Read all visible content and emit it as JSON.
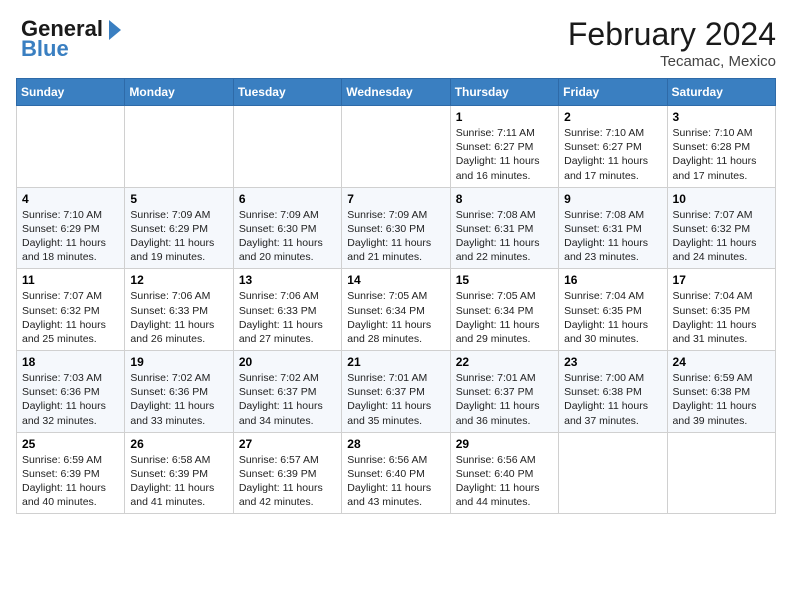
{
  "header": {
    "logo_line1": "General",
    "logo_line2": "Blue",
    "month_title": "February 2024",
    "location": "Tecamac, Mexico"
  },
  "weekdays": [
    "Sunday",
    "Monday",
    "Tuesday",
    "Wednesday",
    "Thursday",
    "Friday",
    "Saturday"
  ],
  "weeks": [
    [
      {
        "day": "",
        "info": ""
      },
      {
        "day": "",
        "info": ""
      },
      {
        "day": "",
        "info": ""
      },
      {
        "day": "",
        "info": ""
      },
      {
        "day": "1",
        "info": "Sunrise: 7:11 AM\nSunset: 6:27 PM\nDaylight: 11 hours and 16 minutes."
      },
      {
        "day": "2",
        "info": "Sunrise: 7:10 AM\nSunset: 6:27 PM\nDaylight: 11 hours and 17 minutes."
      },
      {
        "day": "3",
        "info": "Sunrise: 7:10 AM\nSunset: 6:28 PM\nDaylight: 11 hours and 17 minutes."
      }
    ],
    [
      {
        "day": "4",
        "info": "Sunrise: 7:10 AM\nSunset: 6:29 PM\nDaylight: 11 hours and 18 minutes."
      },
      {
        "day": "5",
        "info": "Sunrise: 7:09 AM\nSunset: 6:29 PM\nDaylight: 11 hours and 19 minutes."
      },
      {
        "day": "6",
        "info": "Sunrise: 7:09 AM\nSunset: 6:30 PM\nDaylight: 11 hours and 20 minutes."
      },
      {
        "day": "7",
        "info": "Sunrise: 7:09 AM\nSunset: 6:30 PM\nDaylight: 11 hours and 21 minutes."
      },
      {
        "day": "8",
        "info": "Sunrise: 7:08 AM\nSunset: 6:31 PM\nDaylight: 11 hours and 22 minutes."
      },
      {
        "day": "9",
        "info": "Sunrise: 7:08 AM\nSunset: 6:31 PM\nDaylight: 11 hours and 23 minutes."
      },
      {
        "day": "10",
        "info": "Sunrise: 7:07 AM\nSunset: 6:32 PM\nDaylight: 11 hours and 24 minutes."
      }
    ],
    [
      {
        "day": "11",
        "info": "Sunrise: 7:07 AM\nSunset: 6:32 PM\nDaylight: 11 hours and 25 minutes."
      },
      {
        "day": "12",
        "info": "Sunrise: 7:06 AM\nSunset: 6:33 PM\nDaylight: 11 hours and 26 minutes."
      },
      {
        "day": "13",
        "info": "Sunrise: 7:06 AM\nSunset: 6:33 PM\nDaylight: 11 hours and 27 minutes."
      },
      {
        "day": "14",
        "info": "Sunrise: 7:05 AM\nSunset: 6:34 PM\nDaylight: 11 hours and 28 minutes."
      },
      {
        "day": "15",
        "info": "Sunrise: 7:05 AM\nSunset: 6:34 PM\nDaylight: 11 hours and 29 minutes."
      },
      {
        "day": "16",
        "info": "Sunrise: 7:04 AM\nSunset: 6:35 PM\nDaylight: 11 hours and 30 minutes."
      },
      {
        "day": "17",
        "info": "Sunrise: 7:04 AM\nSunset: 6:35 PM\nDaylight: 11 hours and 31 minutes."
      }
    ],
    [
      {
        "day": "18",
        "info": "Sunrise: 7:03 AM\nSunset: 6:36 PM\nDaylight: 11 hours and 32 minutes."
      },
      {
        "day": "19",
        "info": "Sunrise: 7:02 AM\nSunset: 6:36 PM\nDaylight: 11 hours and 33 minutes."
      },
      {
        "day": "20",
        "info": "Sunrise: 7:02 AM\nSunset: 6:37 PM\nDaylight: 11 hours and 34 minutes."
      },
      {
        "day": "21",
        "info": "Sunrise: 7:01 AM\nSunset: 6:37 PM\nDaylight: 11 hours and 35 minutes."
      },
      {
        "day": "22",
        "info": "Sunrise: 7:01 AM\nSunset: 6:37 PM\nDaylight: 11 hours and 36 minutes."
      },
      {
        "day": "23",
        "info": "Sunrise: 7:00 AM\nSunset: 6:38 PM\nDaylight: 11 hours and 37 minutes."
      },
      {
        "day": "24",
        "info": "Sunrise: 6:59 AM\nSunset: 6:38 PM\nDaylight: 11 hours and 39 minutes."
      }
    ],
    [
      {
        "day": "25",
        "info": "Sunrise: 6:59 AM\nSunset: 6:39 PM\nDaylight: 11 hours and 40 minutes."
      },
      {
        "day": "26",
        "info": "Sunrise: 6:58 AM\nSunset: 6:39 PM\nDaylight: 11 hours and 41 minutes."
      },
      {
        "day": "27",
        "info": "Sunrise: 6:57 AM\nSunset: 6:39 PM\nDaylight: 11 hours and 42 minutes."
      },
      {
        "day": "28",
        "info": "Sunrise: 6:56 AM\nSunset: 6:40 PM\nDaylight: 11 hours and 43 minutes."
      },
      {
        "day": "29",
        "info": "Sunrise: 6:56 AM\nSunset: 6:40 PM\nDaylight: 11 hours and 44 minutes."
      },
      {
        "day": "",
        "info": ""
      },
      {
        "day": "",
        "info": ""
      }
    ]
  ]
}
